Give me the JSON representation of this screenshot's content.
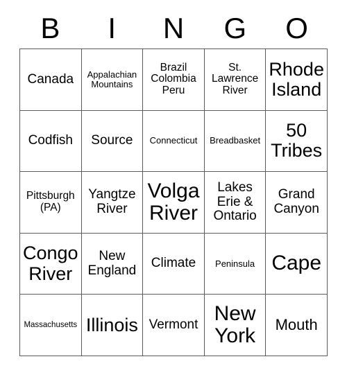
{
  "card": {
    "type": "bingo-card",
    "header_letters": [
      "B",
      "I",
      "N",
      "G",
      "O"
    ],
    "columns": 5,
    "rows": 5,
    "colors": {
      "background": "#ffffff",
      "text": "#000000",
      "grid_line": "#5a5a5a"
    },
    "cells": [
      {
        "text": "Canada",
        "size": "m",
        "row": 1,
        "col": 1
      },
      {
        "text": "Appalachian Mountains",
        "size": "xs",
        "row": 1,
        "col": 2
      },
      {
        "text": "Brazil Colombia Peru",
        "size": "s",
        "row": 1,
        "col": 3
      },
      {
        "text": "St. Lawrence River",
        "size": "s",
        "row": 1,
        "col": 4
      },
      {
        "text": "Rhode Island",
        "size": "xl",
        "row": 1,
        "col": 5
      },
      {
        "text": "Codfish",
        "size": "m",
        "row": 2,
        "col": 1
      },
      {
        "text": "Source",
        "size": "m",
        "row": 2,
        "col": 2
      },
      {
        "text": "Connecticut",
        "size": "xs",
        "row": 2,
        "col": 3
      },
      {
        "text": "Breadbasket",
        "size": "xs",
        "row": 2,
        "col": 4
      },
      {
        "text": "50 Tribes",
        "size": "xl",
        "row": 2,
        "col": 5
      },
      {
        "text": "Pittsburgh (PA)",
        "size": "s",
        "row": 3,
        "col": 1
      },
      {
        "text": "Yangtze River",
        "size": "m",
        "row": 3,
        "col": 2
      },
      {
        "text": "Volga River",
        "size": "xxl",
        "row": 3,
        "col": 3
      },
      {
        "text": "Lakes Erie & Ontario",
        "size": "m",
        "row": 3,
        "col": 4
      },
      {
        "text": "Grand Canyon",
        "size": "m",
        "row": 3,
        "col": 5
      },
      {
        "text": "Congo River",
        "size": "xl",
        "row": 4,
        "col": 1
      },
      {
        "text": "New England",
        "size": "m",
        "row": 4,
        "col": 2
      },
      {
        "text": "Climate",
        "size": "m",
        "row": 4,
        "col": 3
      },
      {
        "text": "Peninsula",
        "size": "xs",
        "row": 4,
        "col": 4
      },
      {
        "text": "Cape",
        "size": "xxl",
        "row": 4,
        "col": 5
      },
      {
        "text": "Massachusetts",
        "size": "xxs",
        "row": 5,
        "col": 1
      },
      {
        "text": "Illinois",
        "size": "xl",
        "row": 5,
        "col": 2
      },
      {
        "text": "Vermont",
        "size": "m",
        "row": 5,
        "col": 3
      },
      {
        "text": "New York",
        "size": "xxl",
        "row": 5,
        "col": 4
      },
      {
        "text": "Mouth",
        "size": "l",
        "row": 5,
        "col": 5
      }
    ]
  }
}
